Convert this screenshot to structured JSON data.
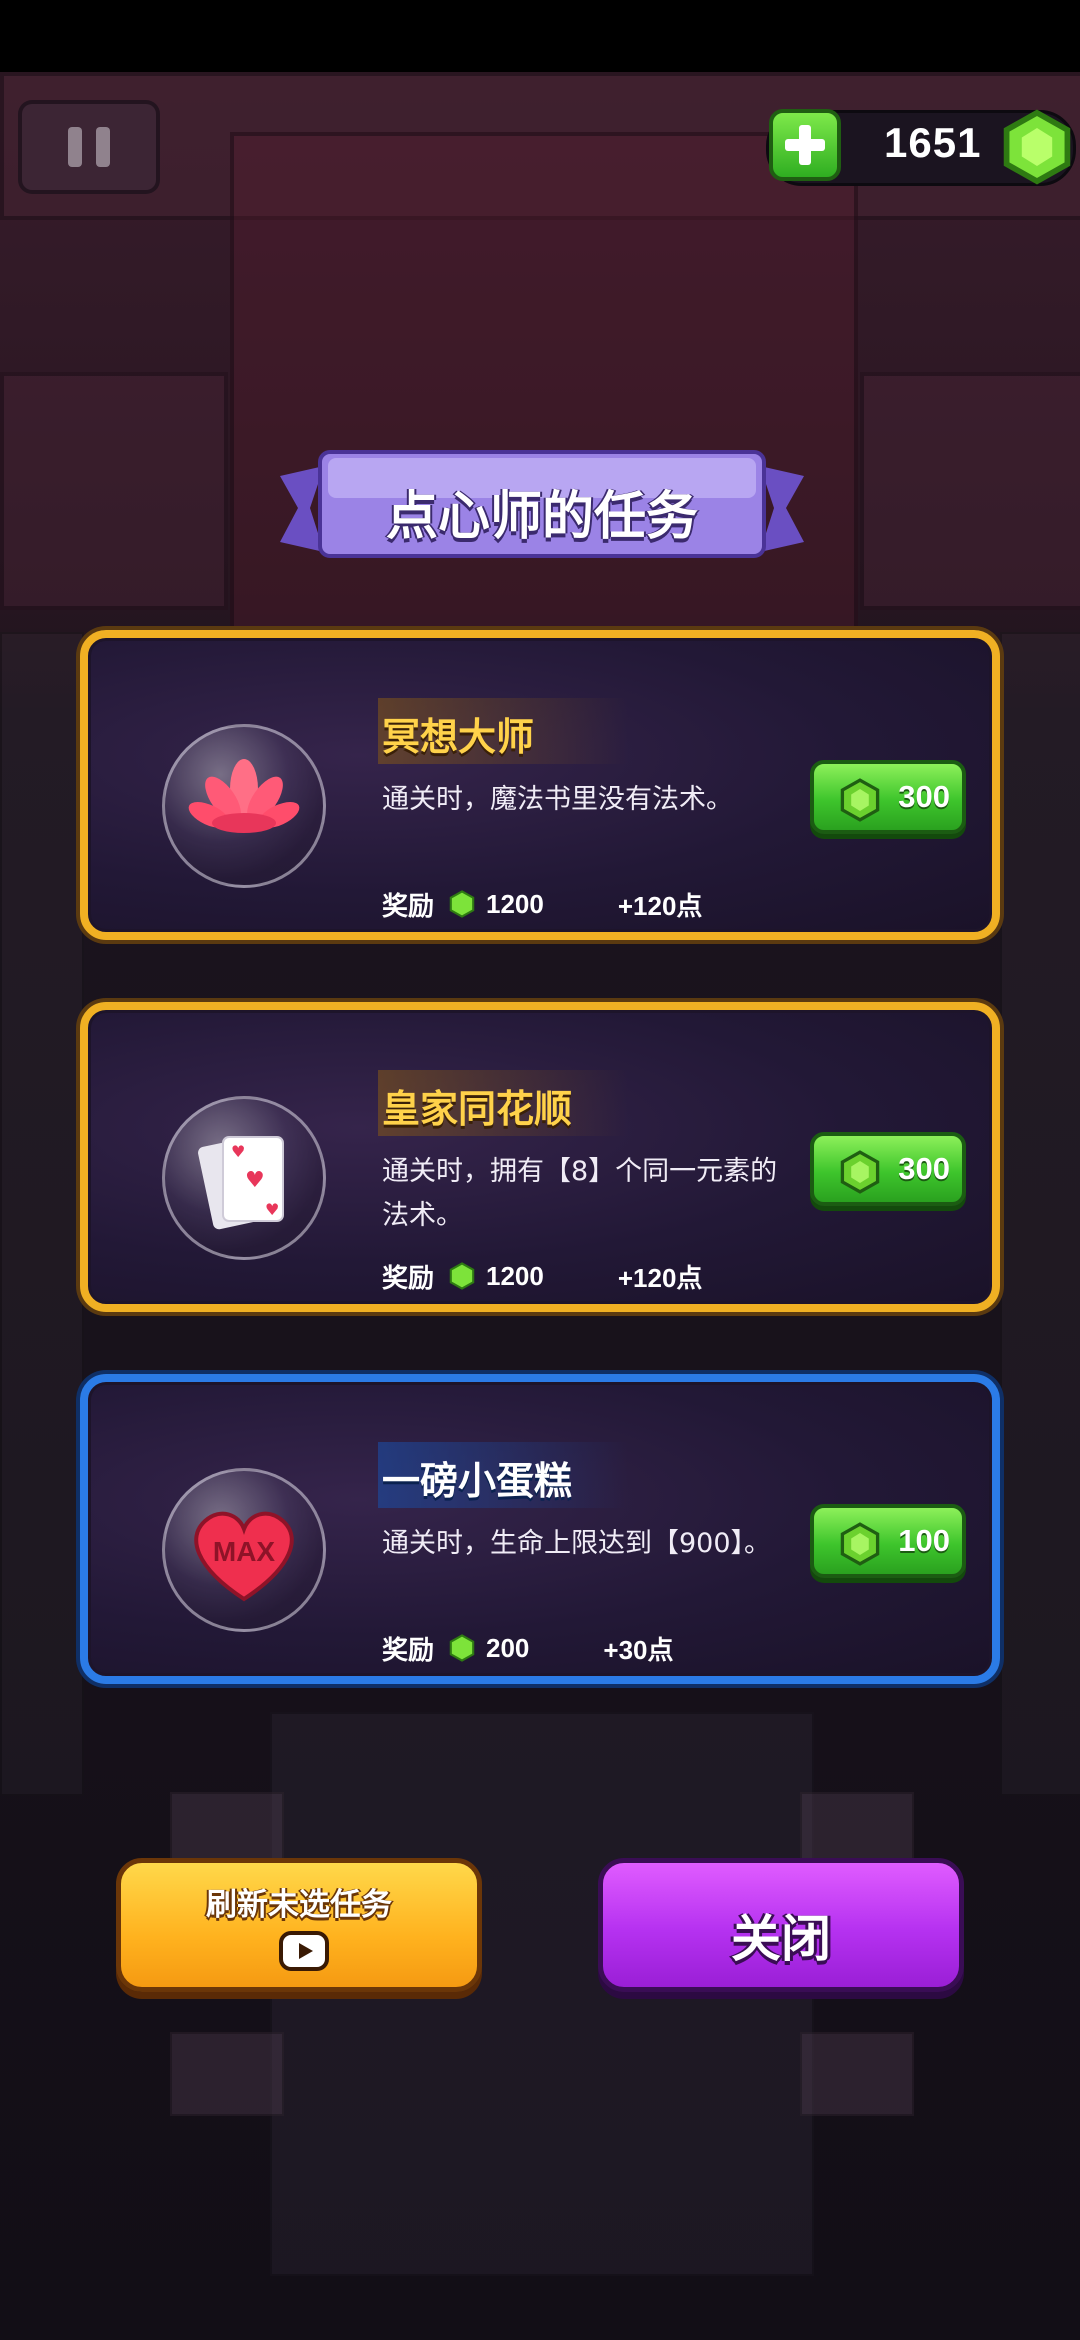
{
  "header": {
    "gem_count": "1651"
  },
  "dialog": {
    "title": "点心师的任务"
  },
  "quests": [
    {
      "title": "冥想大师",
      "description": "通关时，魔法书里没有法术。",
      "reward_label": "奖励",
      "reward_gems": "1200",
      "reward_points": "+120点",
      "cost": "300",
      "icon": "lotus-icon",
      "frame_color": "#f0b023"
    },
    {
      "title": "皇家同花顺",
      "description": "通关时，拥有【8】个同一元素的法术。",
      "reward_label": "奖励",
      "reward_gems": "1200",
      "reward_points": "+120点",
      "cost": "300",
      "icon": "playing-cards-icon",
      "frame_color": "#f0b023"
    },
    {
      "title": "一磅小蛋糕",
      "description": "通关时，生命上限达到【900】。",
      "reward_label": "奖励",
      "reward_gems": "200",
      "reward_points": "+30点",
      "cost": "100",
      "icon": "max-heart-icon",
      "icon_text": "MAX",
      "frame_color": "#2b7be6"
    }
  ],
  "footer": {
    "refresh_label": "刷新未选任务",
    "close_label": "关闭"
  }
}
